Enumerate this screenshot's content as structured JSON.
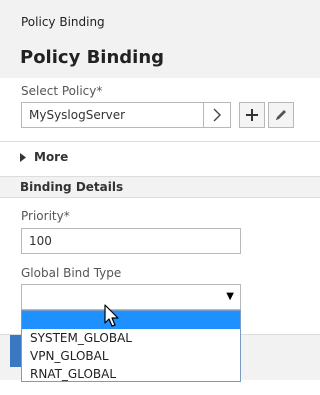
{
  "header": {
    "breadcrumb": "Policy Binding",
    "title": "Policy Binding"
  },
  "select_policy": {
    "label": "Select Policy*",
    "value": "MySyslogServer",
    "arrow_icon": "chevron-right-icon",
    "add_icon": "plus-icon",
    "edit_icon": "pencil-icon"
  },
  "more": {
    "label": "More",
    "icon": "caret-right-icon"
  },
  "binding_details": {
    "title": "Binding Details",
    "priority_label": "Priority*",
    "priority_value": "100",
    "bind_type_label": "Global Bind Type",
    "bind_type_value": "",
    "bind_type_options": [
      "",
      "SYSTEM_GLOBAL",
      "VPN_GLOBAL",
      "RNAT_GLOBAL"
    ],
    "highlighted_option_index": 0
  },
  "colors": {
    "highlight": "#1e90ff",
    "primary_button": "#3a78c3"
  }
}
